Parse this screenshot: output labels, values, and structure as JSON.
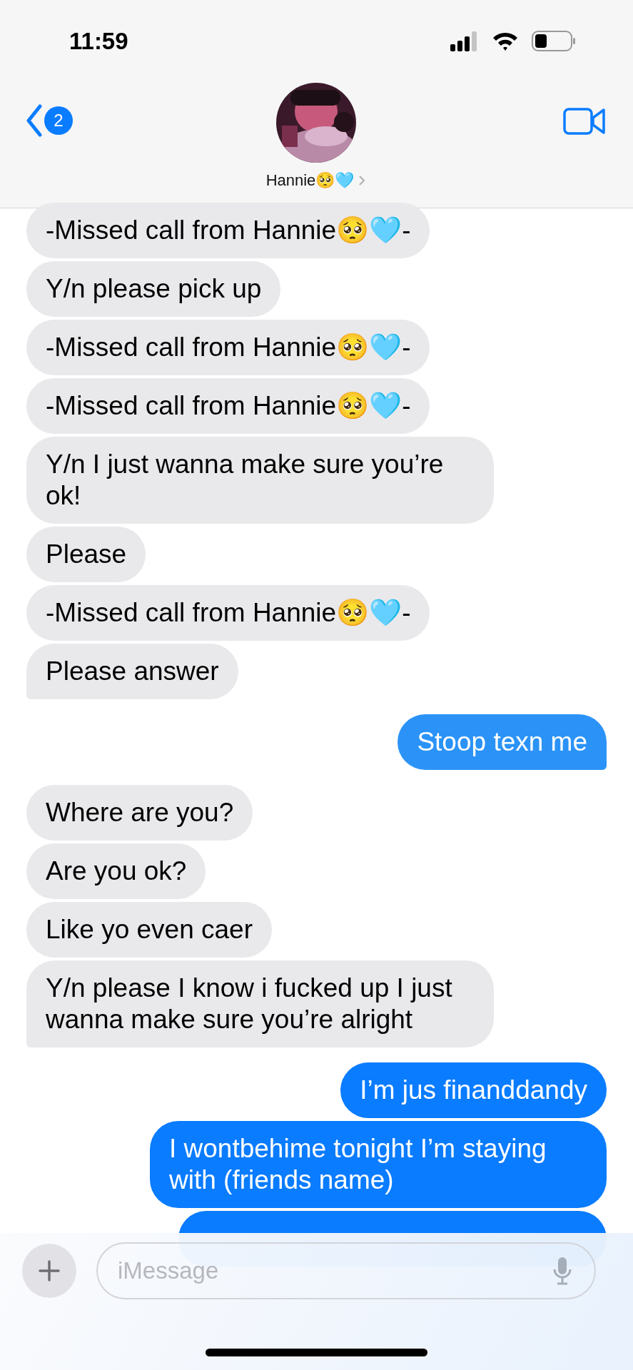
{
  "status_bar": {
    "time": "11:59"
  },
  "header": {
    "back_count": "2",
    "contact_name": "Hannie🥺🩵"
  },
  "messages": [
    {
      "kind": "received",
      "text": "-Missed call from Hannie🥺🩵-",
      "tail": false
    },
    {
      "kind": "received",
      "text": "Y/n please pick up",
      "tail": false
    },
    {
      "kind": "received",
      "text": "-Missed call from Hannie🥺🩵-",
      "tail": false
    },
    {
      "kind": "received",
      "text": "-Missed call from Hannie🥺🩵-",
      "tail": false
    },
    {
      "kind": "received",
      "text": "Y/n I just wanna make sure you’re ok!",
      "tail": false
    },
    {
      "kind": "received",
      "text": "Please",
      "tail": false
    },
    {
      "kind": "received",
      "text": "-Missed call from Hannie🥺🩵-",
      "tail": false
    },
    {
      "kind": "received",
      "text": "Please answer",
      "tail": true
    },
    {
      "kind": "sent",
      "text": "Stoop texn me",
      "tail": true,
      "color": "#2b93f7"
    },
    {
      "kind": "received",
      "text": "Where are you?",
      "tail": false
    },
    {
      "kind": "received",
      "text": "Are you ok?",
      "tail": false
    },
    {
      "kind": "received",
      "text": "Like yo even caer",
      "tail": false
    },
    {
      "kind": "received",
      "text": "Y/n please I know i fucked up I just wanna make sure you’re alright",
      "tail": true
    },
    {
      "kind": "sent",
      "text": "I’m jus finanddandy",
      "tail": false,
      "color": "#0a7cff"
    },
    {
      "kind": "sent",
      "text": "I wontbehime tonight I’m staying with (friends name)",
      "tail": false,
      "color": "#0a7cff"
    },
    {
      "kind": "sent",
      "color": "#0a7cff"
    }
  ],
  "composer": {
    "placeholder": "iMessage"
  }
}
